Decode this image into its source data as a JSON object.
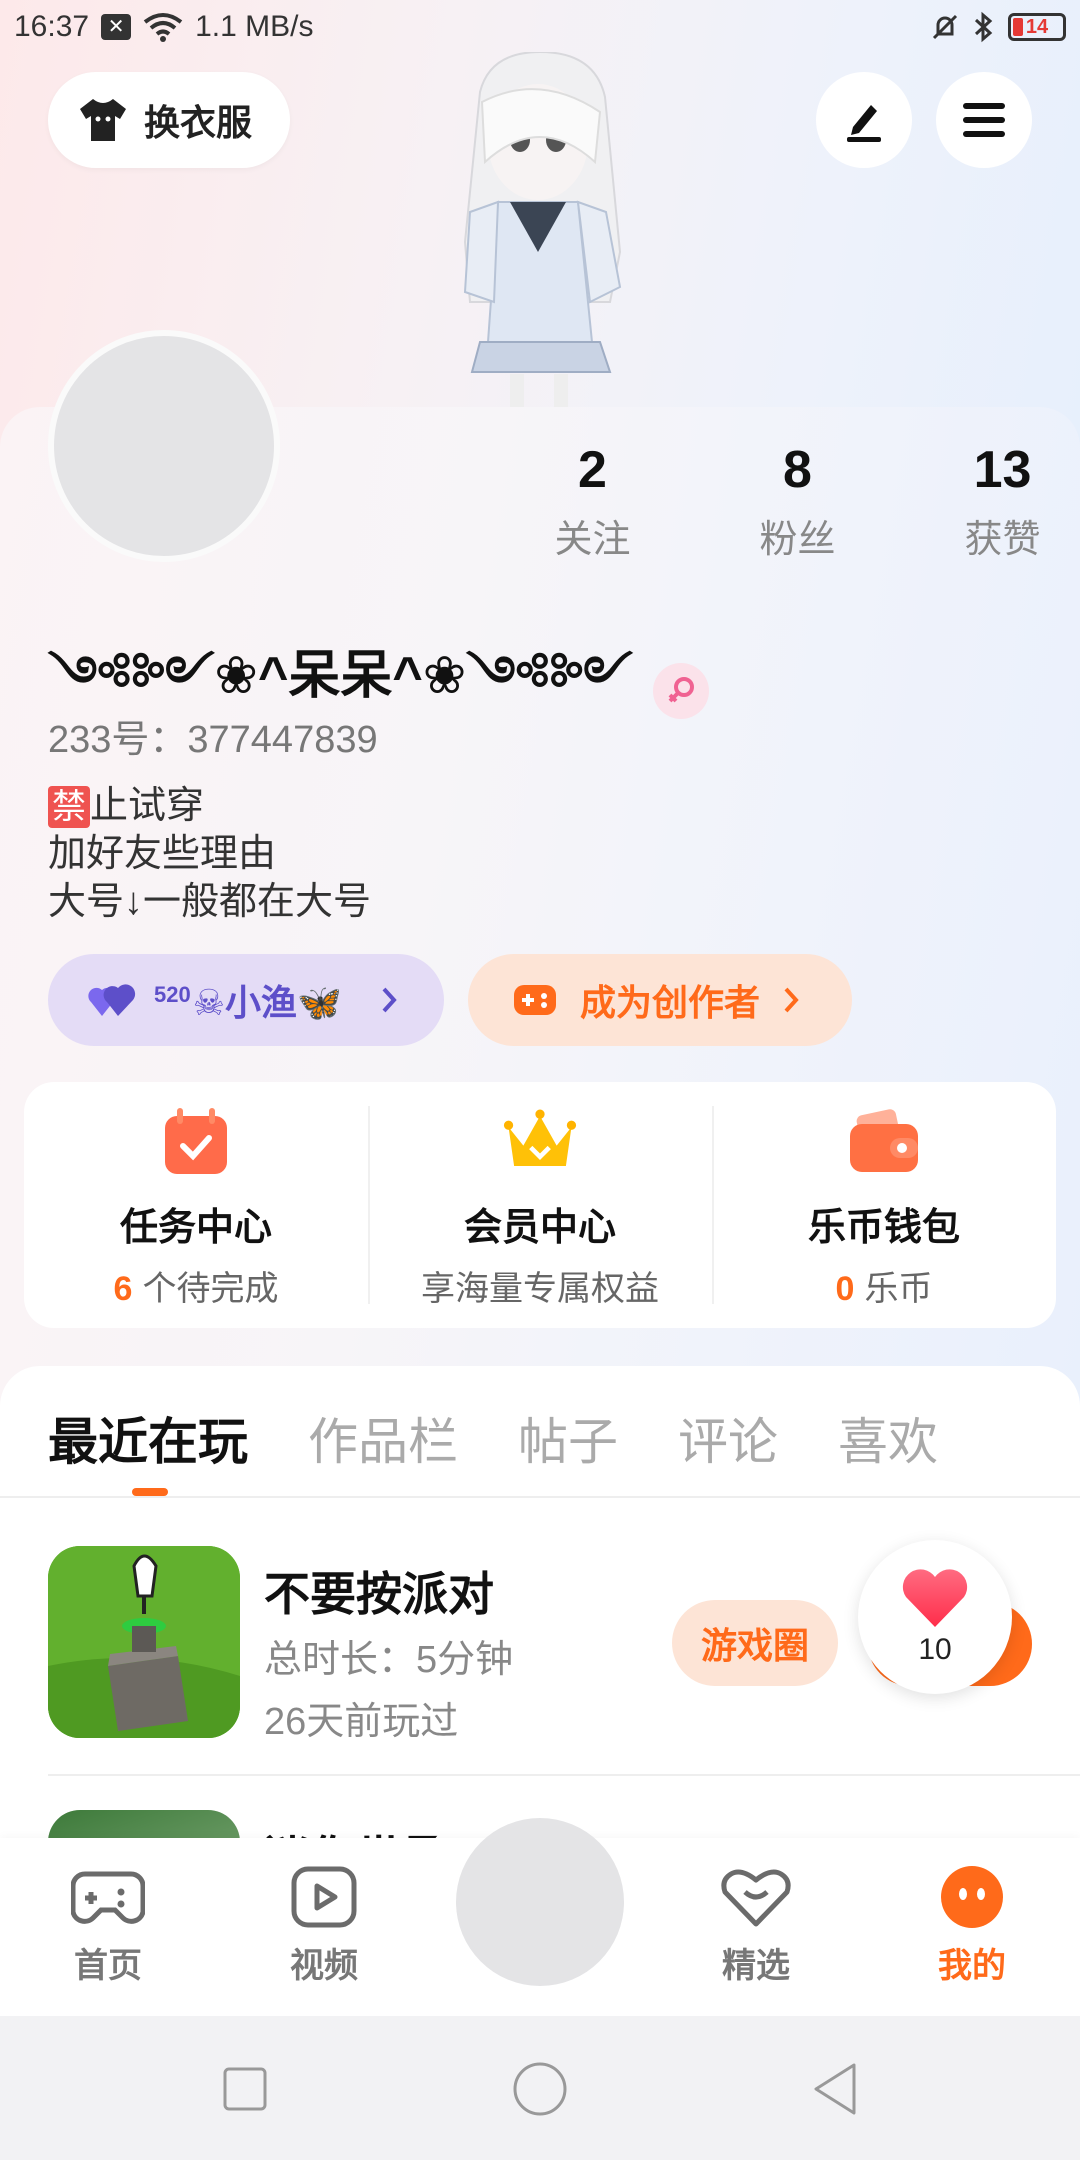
{
  "status_bar": {
    "time": "16:37",
    "network_speed": "1.1 MB/s",
    "battery": "14"
  },
  "top": {
    "change_clothes_label": "换衣服",
    "edit_icon": "pen-icon",
    "menu_icon": "hamburger-icon"
  },
  "stats": [
    {
      "value": "2",
      "label": "关注"
    },
    {
      "value": "8",
      "label": "粉丝"
    },
    {
      "value": "13",
      "label": "获赞"
    }
  ],
  "profile": {
    "nickname": "༺༻❀^呆呆^❀༺༻",
    "gender_icon": "female-icon",
    "user_id": "233号：377447839",
    "bio_ban_char": "禁",
    "bio_line1_rest": "止试穿",
    "bio_line2": "加好友些理由",
    "bio_line3": "大号↓一般都在大号"
  },
  "pills": {
    "fish_sup": "520",
    "fish_label": "☠小渔🦋",
    "creator_label": "成为创作者"
  },
  "features": [
    {
      "title": "任务中心",
      "highlight": "6",
      "sub": "个待完成",
      "icon": "calendar-check-icon"
    },
    {
      "title": "会员中心",
      "highlight": "",
      "sub": "享海量专属权益",
      "icon": "crown-icon"
    },
    {
      "title": "乐币钱包",
      "highlight": "0",
      "sub": "乐币",
      "icon": "wallet-icon"
    }
  ],
  "tabs": [
    "最近在玩",
    "作品栏",
    "帖子",
    "评论",
    "喜欢"
  ],
  "games": [
    {
      "name": "不要按派对",
      "duration": "总时长：5分钟",
      "last_played": "26天前玩过",
      "button": "游戏圈"
    },
    {
      "name": "迷你世界"
    }
  ],
  "floating_heart": {
    "count": "10"
  },
  "bottom_nav": [
    {
      "label": "首页",
      "icon": "gamepad-icon",
      "active": false
    },
    {
      "label": "视频",
      "icon": "play-icon",
      "active": false
    },
    {
      "label": "精选",
      "icon": "heart-chat-icon",
      "active": false
    },
    {
      "label": "我的",
      "icon": "face-icon",
      "active": true
    }
  ],
  "colors": {
    "accent": "#ff6a1a",
    "purple": "#5d4fc9"
  }
}
